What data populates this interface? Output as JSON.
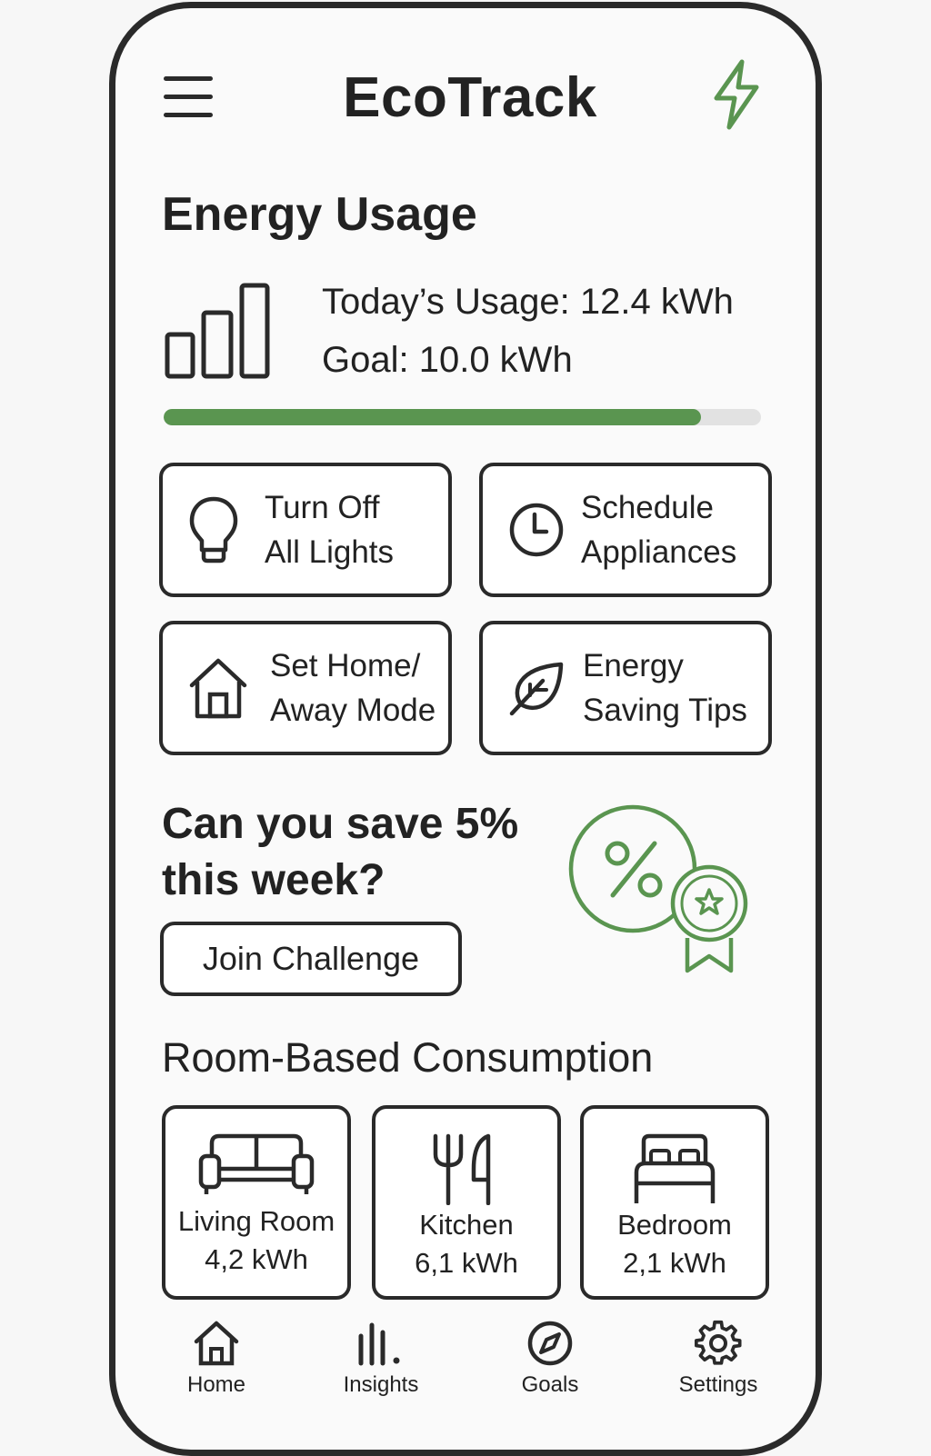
{
  "header": {
    "title": "EcoTrack",
    "menu_icon": "hamburger-menu-icon",
    "right_icon": "lightning-bolt-icon"
  },
  "colors": {
    "accent": "#5a9550",
    "border": "#2a2a2a",
    "track": "#e2e2e2"
  },
  "energy": {
    "title": "Energy Usage",
    "today": "Today’s Usage: 12.4 kWh",
    "goal": "Goal: 10.0 kWh",
    "progress_percent": 90,
    "icon": "bar-chart-icon"
  },
  "actions": [
    {
      "line1": "Turn Off",
      "line2": "All Lights",
      "icon": "lightbulb-icon"
    },
    {
      "line1": "Schedule",
      "line2": "Appliances",
      "icon": "clock-icon"
    },
    {
      "line1": "Set Home/",
      "line2": "Away Mode",
      "icon": "house-icon"
    },
    {
      "line1": "Energy",
      "line2": "Saving Tips",
      "icon": "leaf-icon"
    }
  ],
  "challenge": {
    "line1": "Can you save 5%",
    "line2": "this week?",
    "button": "Join Challenge",
    "icon": "percent-badge-icon"
  },
  "rooms": {
    "title": "Room-Based Consumption",
    "items": [
      {
        "name": "Living Room",
        "value": "4,2 kWh",
        "icon": "sofa-icon"
      },
      {
        "name": "Kitchen",
        "value": "6,1 kWh",
        "icon": "fork-knife-icon"
      },
      {
        "name": "Bedroom",
        "value": "2,1 kWh",
        "icon": "bed-icon"
      }
    ]
  },
  "nav": [
    {
      "label": "Home",
      "icon": "home-icon"
    },
    {
      "label": "Insights",
      "icon": "insights-icon"
    },
    {
      "label": "Goals",
      "icon": "compass-icon"
    },
    {
      "label": "Settings",
      "icon": "gear-icon"
    }
  ]
}
